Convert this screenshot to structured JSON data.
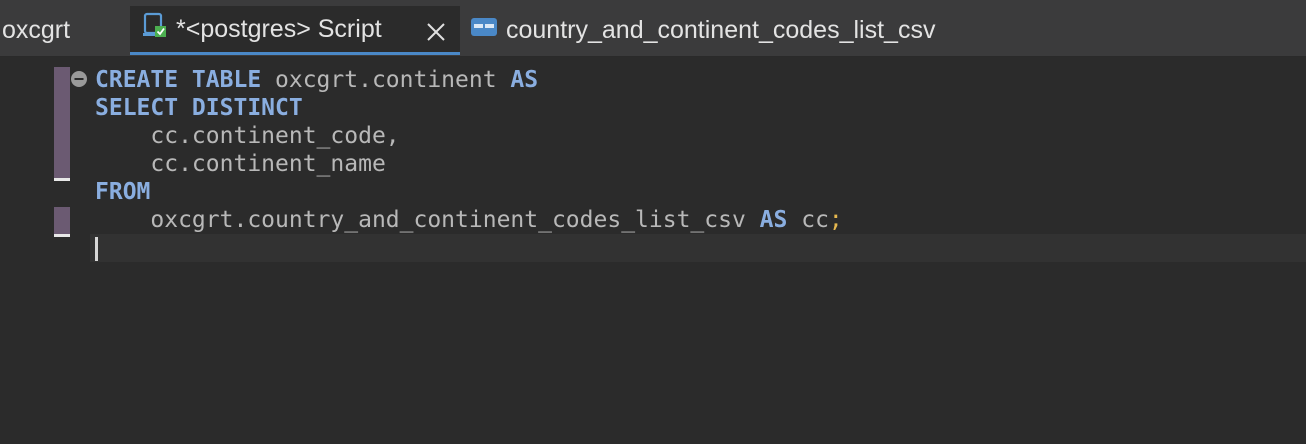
{
  "tabs": [
    {
      "label": "oxcgrt"
    },
    {
      "label": "*<postgres> Script",
      "active": true,
      "icon": "sql-script-icon"
    },
    {
      "label": "country_and_continent_codes_list_csv",
      "icon": "table-icon"
    }
  ],
  "editor": {
    "lines": [
      {
        "kw1": "CREATE TABLE",
        "text1": " oxcgrt.continent ",
        "kw2": "AS"
      },
      {
        "kw1": "SELECT DISTINCT"
      },
      {
        "text1": "    cc.continent_code,"
      },
      {
        "text1": "    cc.continent_name"
      },
      {
        "kw1": "FROM"
      },
      {
        "text1": "    oxcgrt.country_and_continent_codes_list_csv ",
        "kw2": "AS",
        "text2": " cc",
        "punct": ";"
      }
    ]
  },
  "colors": {
    "keyword": "#8aaee0",
    "identifier": "#b8b8b8",
    "semicolon": "#e6b84f",
    "active_tab_underline": "#4a88c7",
    "change_marker": "#6b5a72"
  }
}
